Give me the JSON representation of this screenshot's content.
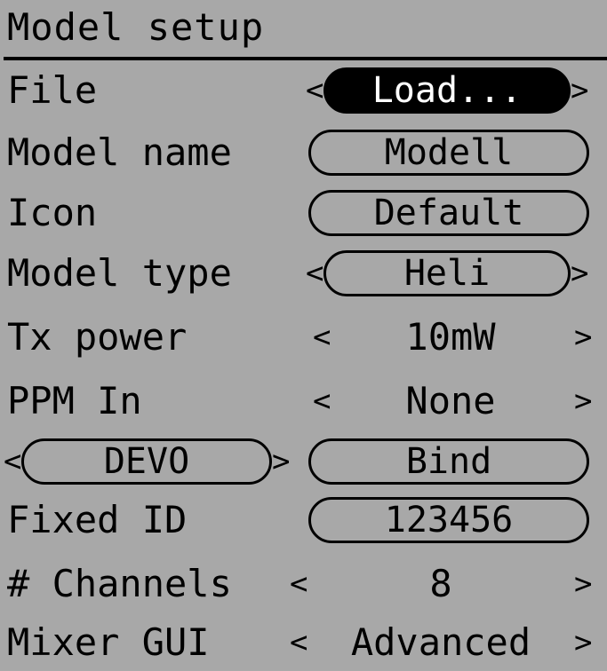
{
  "title": "Model setup",
  "rows": [
    {
      "label": "File",
      "value": "Load..."
    },
    {
      "label": "Model name",
      "value": "Modell"
    },
    {
      "label": "Icon",
      "value": "Default"
    },
    {
      "label": "Model type",
      "value": "Heli"
    },
    {
      "label": "Tx power",
      "value": "10mW"
    },
    {
      "label": "PPM In",
      "value": "None"
    },
    {
      "label": "DEVO",
      "value": "Bind"
    },
    {
      "label": "Fixed ID",
      "value": "123456"
    },
    {
      "label": "# Channels",
      "value": "8"
    },
    {
      "label": "Mixer GUI",
      "value": "Advanced"
    }
  ],
  "arrows": {
    "left": "<",
    "right": ">"
  }
}
